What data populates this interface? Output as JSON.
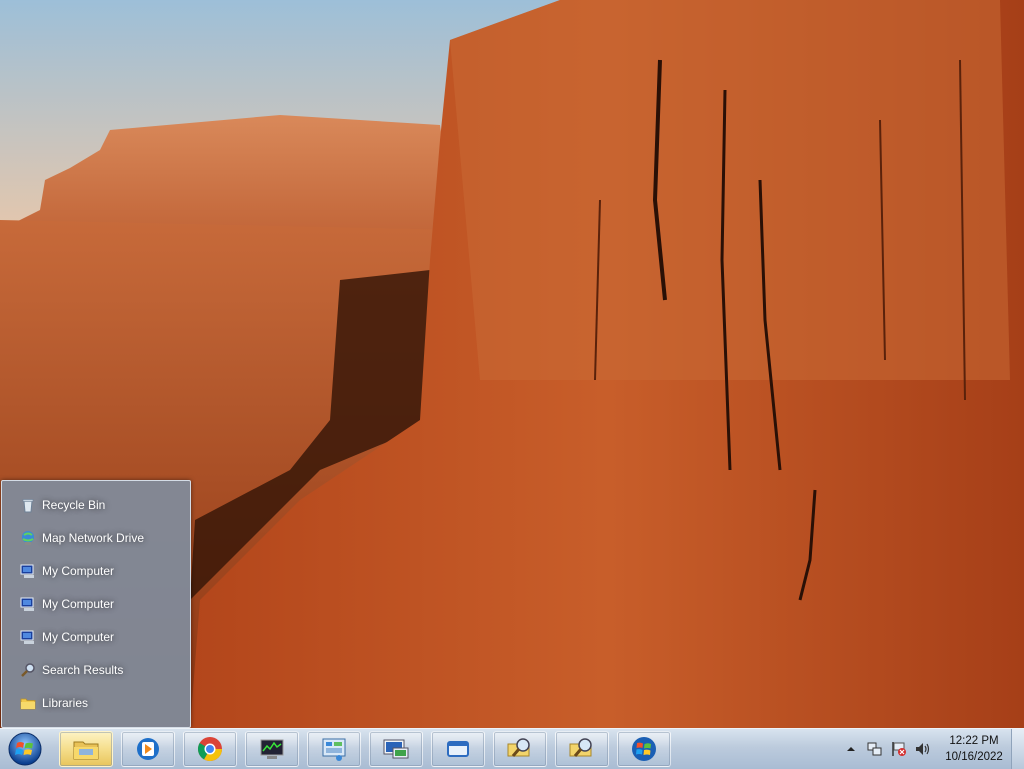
{
  "jump_list": {
    "items": [
      {
        "label": "Recycle Bin",
        "icon": "recycle-bin-icon"
      },
      {
        "label": "Map Network Drive",
        "icon": "network-drive-icon"
      },
      {
        "label": "My Computer",
        "icon": "computer-icon"
      },
      {
        "label": "My Computer",
        "icon": "computer-icon"
      },
      {
        "label": "My Computer",
        "icon": "computer-icon"
      },
      {
        "label": "Search Results",
        "icon": "search-results-icon"
      },
      {
        "label": "Libraries",
        "icon": "folder-icon"
      }
    ]
  },
  "taskbar": {
    "pinned": [
      {
        "name": "file-explorer",
        "icon": "file-explorer-icon",
        "active": true
      },
      {
        "name": "media-player",
        "icon": "media-player-icon",
        "active": false
      },
      {
        "name": "chrome",
        "icon": "chrome-icon",
        "active": false
      },
      {
        "name": "system-monitor",
        "icon": "monitor-icon",
        "active": false
      },
      {
        "name": "control-panel",
        "icon": "control-panel-icon",
        "active": false
      },
      {
        "name": "remote-desktop",
        "icon": "remote-desktop-icon",
        "active": false
      },
      {
        "name": "window-app",
        "icon": "window-icon",
        "active": false
      },
      {
        "name": "search-1",
        "icon": "search-icon",
        "active": false
      },
      {
        "name": "search-2",
        "icon": "search-icon",
        "active": false
      },
      {
        "name": "windows-app",
        "icon": "windows-logo-icon",
        "active": false
      }
    ]
  },
  "tray": {
    "time": "12:22 PM",
    "date": "10/16/2022"
  },
  "colors": {
    "taskbar": "#bccbdd",
    "popup": "#808c9c",
    "accent": "#f5de8c"
  }
}
